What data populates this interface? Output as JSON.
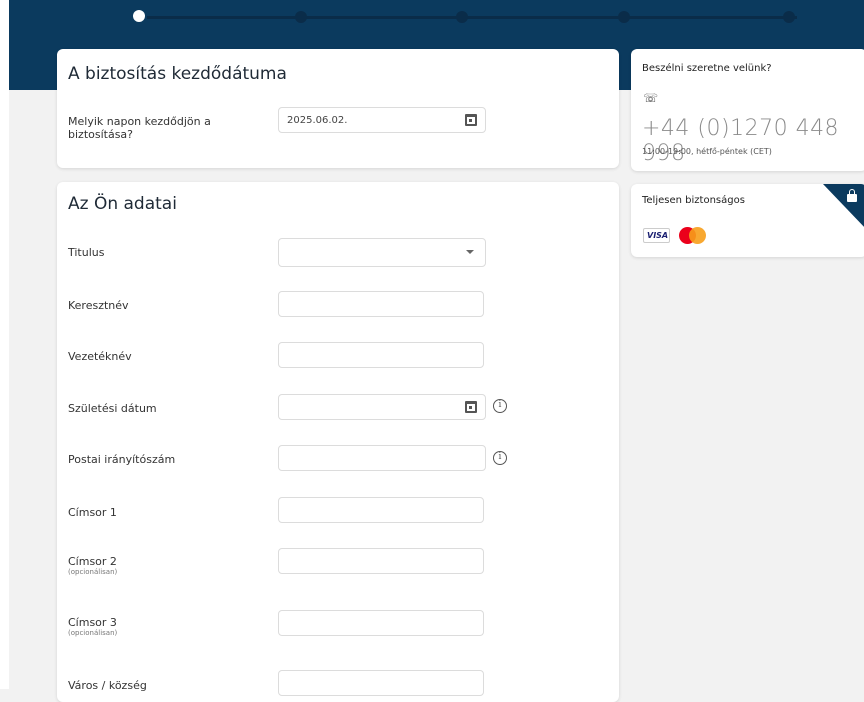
{
  "progress": {
    "steps": 5,
    "active_step": 1
  },
  "start_card": {
    "title": "A biztosítás kezdődátuma",
    "question": "Melyik napon kezdődjön a biztosítása?",
    "date_value": "2025.06.02."
  },
  "details_card": {
    "title": "Az Ön adatai",
    "fields": {
      "title": {
        "label": "Titulus",
        "value": ""
      },
      "first_name": {
        "label": "Keresztnév",
        "value": ""
      },
      "last_name": {
        "label": "Vezetéknév",
        "value": ""
      },
      "birth_date": {
        "label": "Születési dátum",
        "value": ""
      },
      "postcode": {
        "label": "Postai irányítószám",
        "value": ""
      },
      "address1": {
        "label": "Címsor 1",
        "value": ""
      },
      "address2": {
        "label": "Címsor 2",
        "sub": "(opcionálisan)",
        "value": ""
      },
      "address3": {
        "label": "Címsor 3",
        "sub": "(opcionálisan)",
        "value": ""
      },
      "city": {
        "label": "Város / község",
        "value": ""
      }
    }
  },
  "contact_card": {
    "title": "Beszélni szeretne velünk?",
    "phone": "+44 (0)1270 448 998",
    "hours": "11:00-19:00, hétfő-péntek (CET)"
  },
  "secure_card": {
    "title": "Teljesen biztonságos",
    "visa_text": "VISA"
  },
  "colors": {
    "brand": "#0b3a5e",
    "mastercard_red": "#eb001b",
    "mastercard_orange": "#f79e1b"
  },
  "icons": [
    "calendar-icon",
    "chevron-down-icon",
    "info-icon",
    "phone-icon",
    "lock-icon",
    "visa-logo",
    "mastercard-logo"
  ]
}
